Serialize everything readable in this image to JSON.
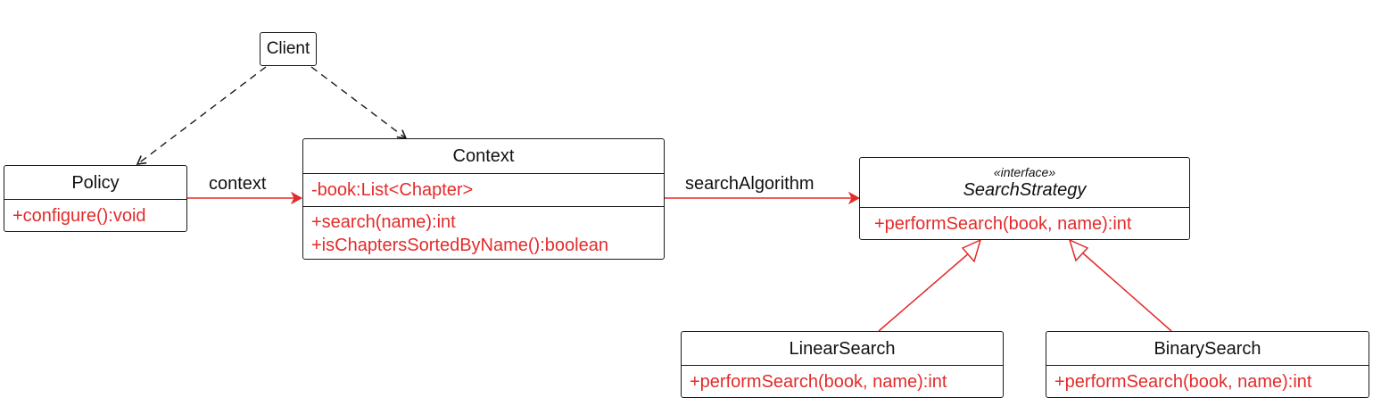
{
  "colors": {
    "line": "#1a1a1a",
    "member": "#e32b2b",
    "association": "#e32b2b"
  },
  "client": {
    "name": "Client"
  },
  "policy": {
    "name": "Policy",
    "methods": [
      "+configure():void"
    ]
  },
  "context": {
    "name": "Context",
    "attributes": [
      "-book:List<Chapter>"
    ],
    "methods": [
      "+search(name):int",
      "+isChaptersSortedByName():boolean"
    ]
  },
  "search_strategy": {
    "stereotype": "«interface»",
    "name": "SearchStrategy",
    "methods": [
      "+performSearch(book, name):int"
    ]
  },
  "linear_search": {
    "name": "LinearSearch",
    "methods": [
      "+performSearch(book, name):int"
    ]
  },
  "binary_search": {
    "name": "BinarySearch",
    "methods": [
      "+performSearch(book, name):int"
    ]
  },
  "relations": {
    "policy_context_label": "context",
    "context_strategy_label": "searchAlgorithm"
  }
}
